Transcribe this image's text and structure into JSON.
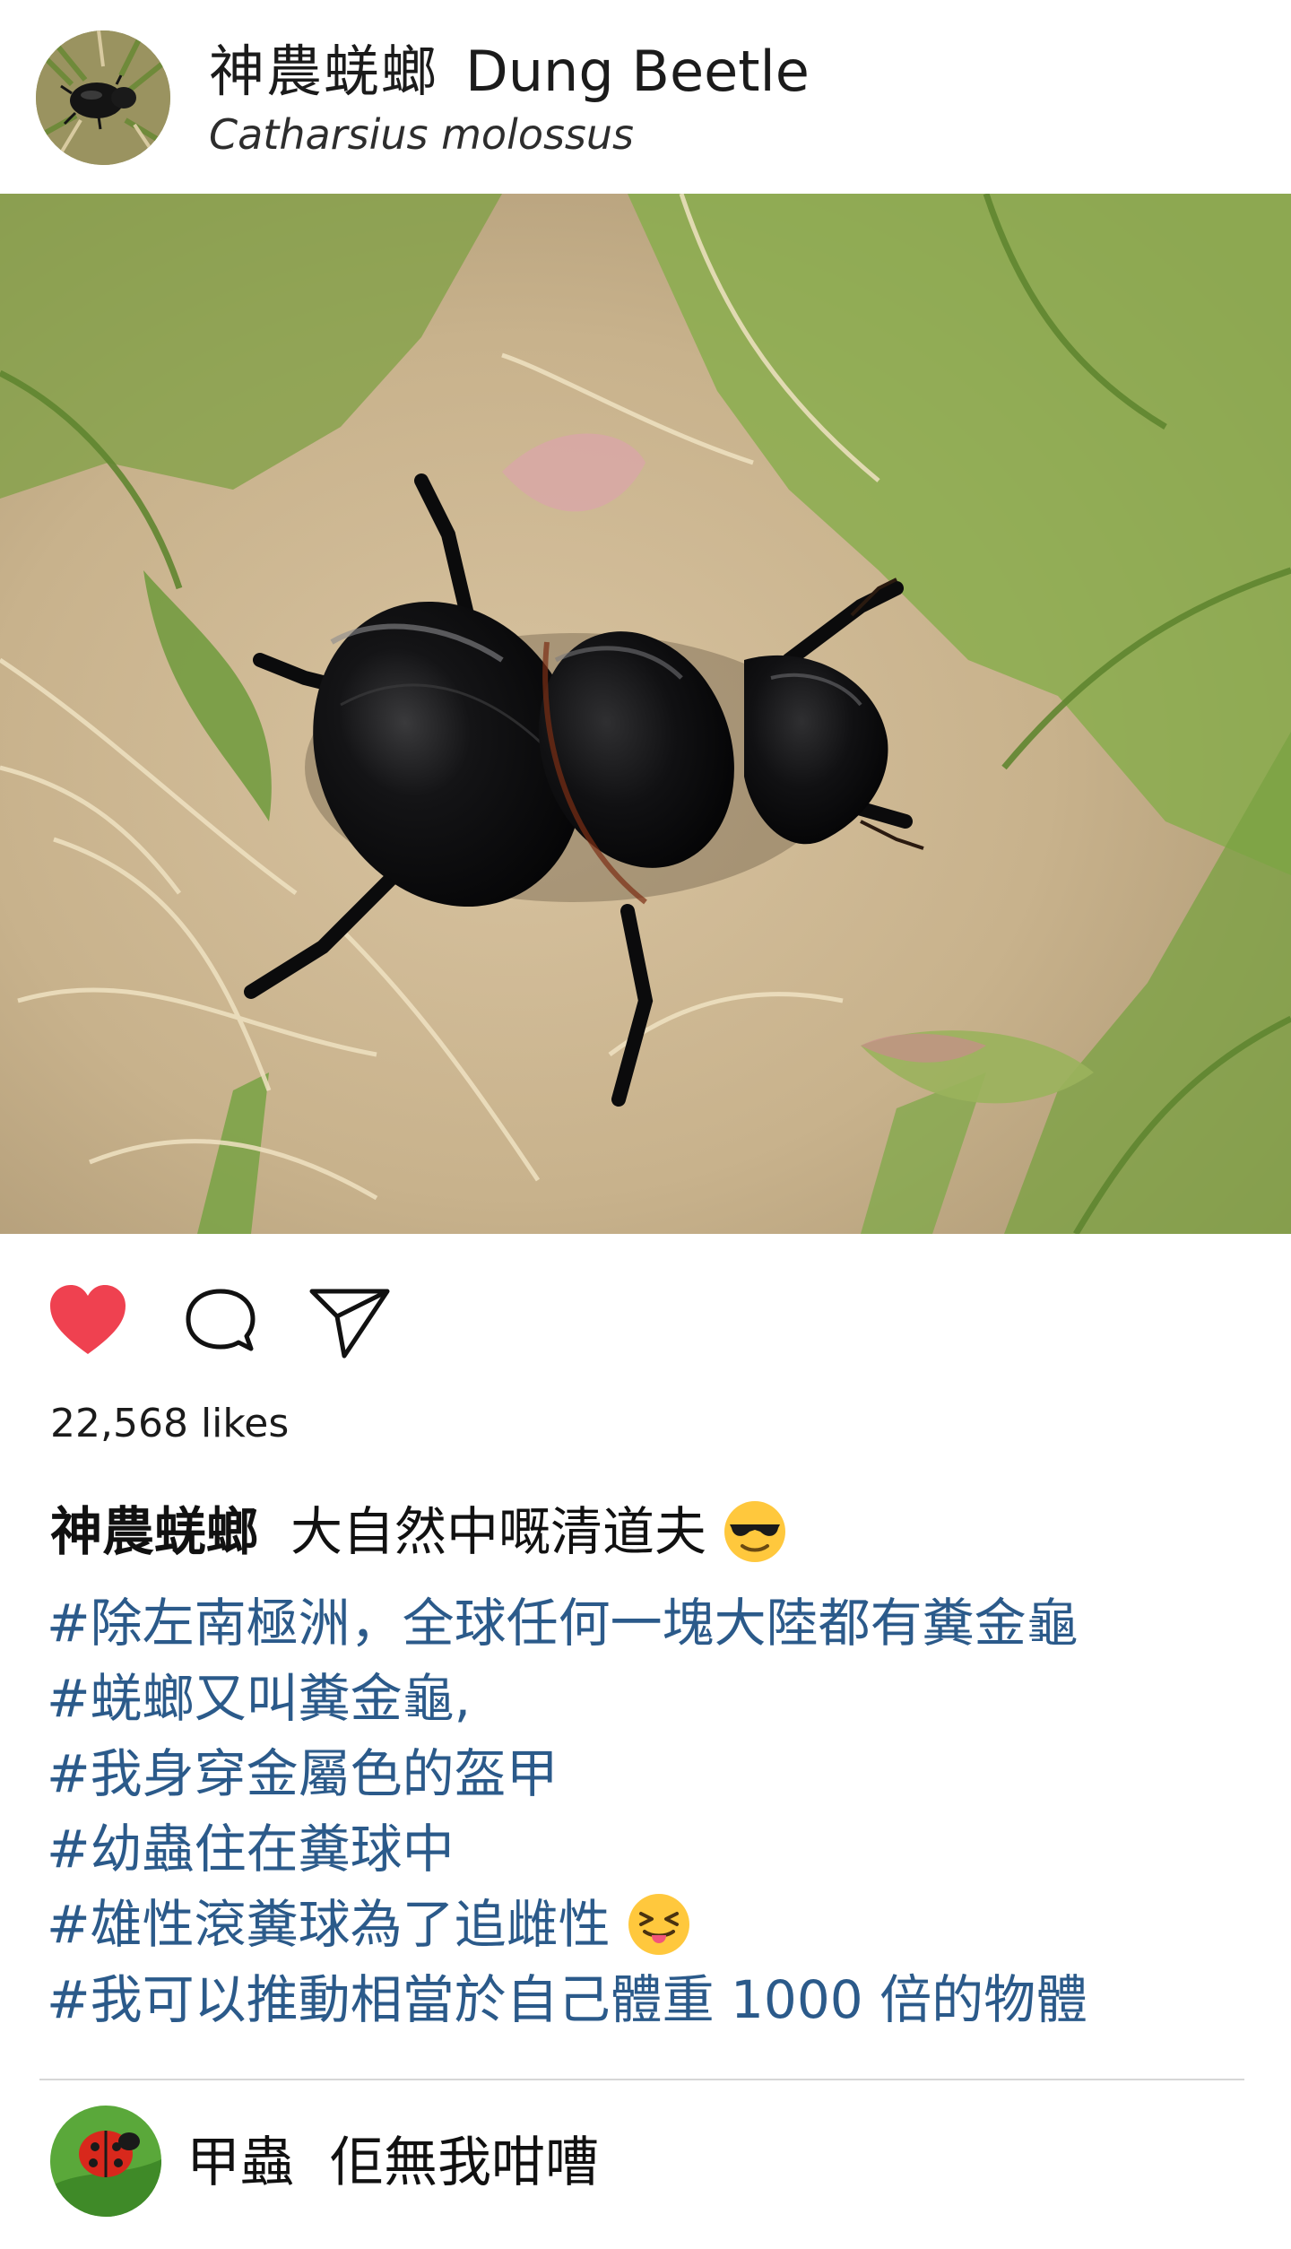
{
  "post": {
    "account_name_zh": "神農蜣螂",
    "account_name_en": "Dung Beetle",
    "account_subtitle": "Catharsius molossus",
    "photo_subject": "dung beetle on grass",
    "likes": "22,568 likes",
    "caption_author": "神農蜣螂",
    "caption_text": "大自然中嘅清道夫",
    "caption_emoji": "smiling-face-with-sunglasses",
    "hashtags": [
      "#除左南極洲，全球任何一塊大陸都有糞金龜",
      "#蜣螂又叫糞金龜,",
      "#我身穿金屬色的盔甲",
      "#幼蟲住在糞球中",
      "#雄性滾糞球為了追雌性",
      "#我可以推動相當於自己體重 1000 倍的物體"
    ],
    "hashtag_emoji": "squinting-face-with-tongue"
  },
  "actions": {
    "like_icon": "heart-icon",
    "like_color": "#ef4150",
    "comment_icon": "speech-bubble-icon",
    "share_icon": "paper-plane-icon"
  },
  "comment": {
    "author": "甲蟲",
    "text": "佢無我咁嘈",
    "avatar": "ladybug"
  },
  "colors": {
    "hashtag": "#2b5a8a",
    "text": "#111111",
    "divider": "#d6d6d6"
  }
}
